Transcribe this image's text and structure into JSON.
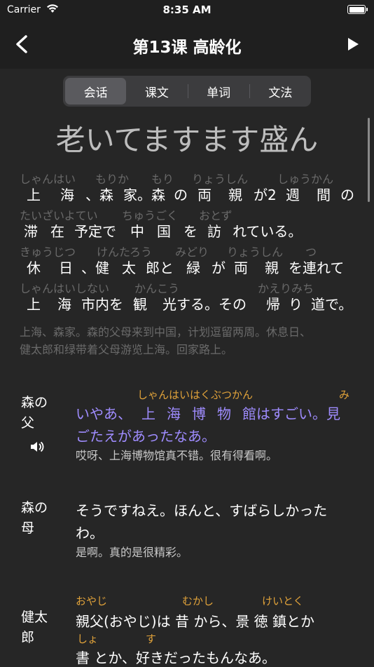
{
  "status": {
    "carrier": "Carrier",
    "time": "8:35 AM",
    "battery_level": 1.0
  },
  "nav": {
    "title": "第13课 高龄化"
  },
  "tabs": [
    {
      "label": "会话",
      "active": true
    },
    {
      "label": "课文",
      "active": false
    },
    {
      "label": "单词",
      "active": false
    },
    {
      "label": "文法",
      "active": false
    }
  ],
  "page_title": "老いてますます盛ん",
  "intro": {
    "ruby": [
      [
        "しゃんはい",
        "もりか",
        "もり",
        "りょうしん",
        "しゅうかん"
      ],
      [
        "たいざいよてい",
        "ちゅうごく",
        "おとず"
      ],
      [
        "きゅうじつ",
        "けんたろう",
        "みどり",
        "りょうしん",
        "つ"
      ],
      [
        "しゃんはいしない",
        "かんこう",
        "かえりみち"
      ]
    ],
    "text": [
      [
        "上",
        "海",
        "、森",
        "家。森",
        "の",
        "両",
        "親",
        "が2",
        "週",
        "間",
        "の"
      ],
      [
        "滞",
        "在",
        "予定で",
        "中",
        "国",
        "を",
        "訪",
        "れている。"
      ],
      [
        "休",
        "日",
        "、健",
        "太",
        "郎と",
        "緑",
        "が",
        "両",
        "親",
        "を連れて"
      ],
      [
        "上",
        "海",
        "市内を",
        "観",
        "光する。その",
        "帰",
        "り",
        "道で。"
      ]
    ],
    "translation": [
      "上海、森家。森的父母来到中国，计划逗留两周。休息日、",
      "健太郎和绿带着父母游览上海。回家路上。"
    ]
  },
  "dialogues": [
    {
      "speaker": [
        "森の",
        "父"
      ],
      "ruby_line1": "しゃんはいはくぶつかん",
      "ruby_line1_b": "み",
      "line1": [
        "いやあ、",
        "上",
        "海",
        "博",
        "物",
        "館",
        "はすごい。見"
      ],
      "line2": "ごたえがあったなあ。",
      "translation": "哎呀、上海博物馆真不错。很有得看啊。"
    },
    {
      "speaker": [
        "森の",
        "母"
      ],
      "line1": "そうですねえ。ほんと、すばらしかった",
      "line2": "わ。",
      "translation": "是啊。真的是很精彩。"
    },
    {
      "speaker": [
        "健太",
        "郎"
      ],
      "ruby_a": "おやじ",
      "ruby_b": "むかし",
      "ruby_c": "けいとく",
      "line1": "親父(おやじ)は 昔 から、景 徳 鎮とか",
      "ruby_d": "しょ",
      "ruby_e": "す",
      "line2": "書 とか、好きだったもんなあ。"
    }
  ]
}
